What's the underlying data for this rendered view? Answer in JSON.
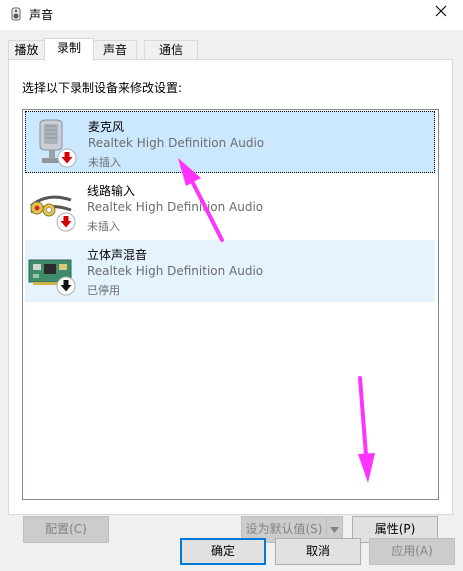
{
  "window": {
    "title": "声音",
    "title_icon": "speaker-icon",
    "close_icon": "close-icon"
  },
  "tabs": [
    {
      "label": "播放",
      "active": false
    },
    {
      "label": "录制",
      "active": true
    },
    {
      "label": "声音",
      "active": false
    },
    {
      "label": "通信",
      "active": false
    }
  ],
  "panel": {
    "instruction": "选择以下录制设备来修改设置:"
  },
  "devices": [
    {
      "name": "麦克风",
      "driver": "Realtek High Definition Audio",
      "status": "未插入",
      "icon": "microphone-icon",
      "badge": "unplugged-badge-icon",
      "state": "selected"
    },
    {
      "name": "线路输入",
      "driver": "Realtek High Definition Audio",
      "status": "未插入",
      "icon": "line-in-icon",
      "badge": "unplugged-badge-icon",
      "state": "normal"
    },
    {
      "name": "立体声混音",
      "driver": "Realtek High Definition Audio",
      "status": "已停用",
      "icon": "stereo-mix-icon",
      "badge": "disabled-badge-icon",
      "state": "hover"
    }
  ],
  "buttons": {
    "configure": "配置(C)",
    "set_default": "设为默认值(S)",
    "properties": "属性(P)",
    "ok": "确定",
    "cancel": "取消",
    "apply": "应用(A)"
  },
  "colors": {
    "accent": "#0078d7",
    "selection": "#cce8ff",
    "hover": "#e5f3ff",
    "annotation_arrow": "#ff33ff",
    "badge_red": "#d40000"
  }
}
